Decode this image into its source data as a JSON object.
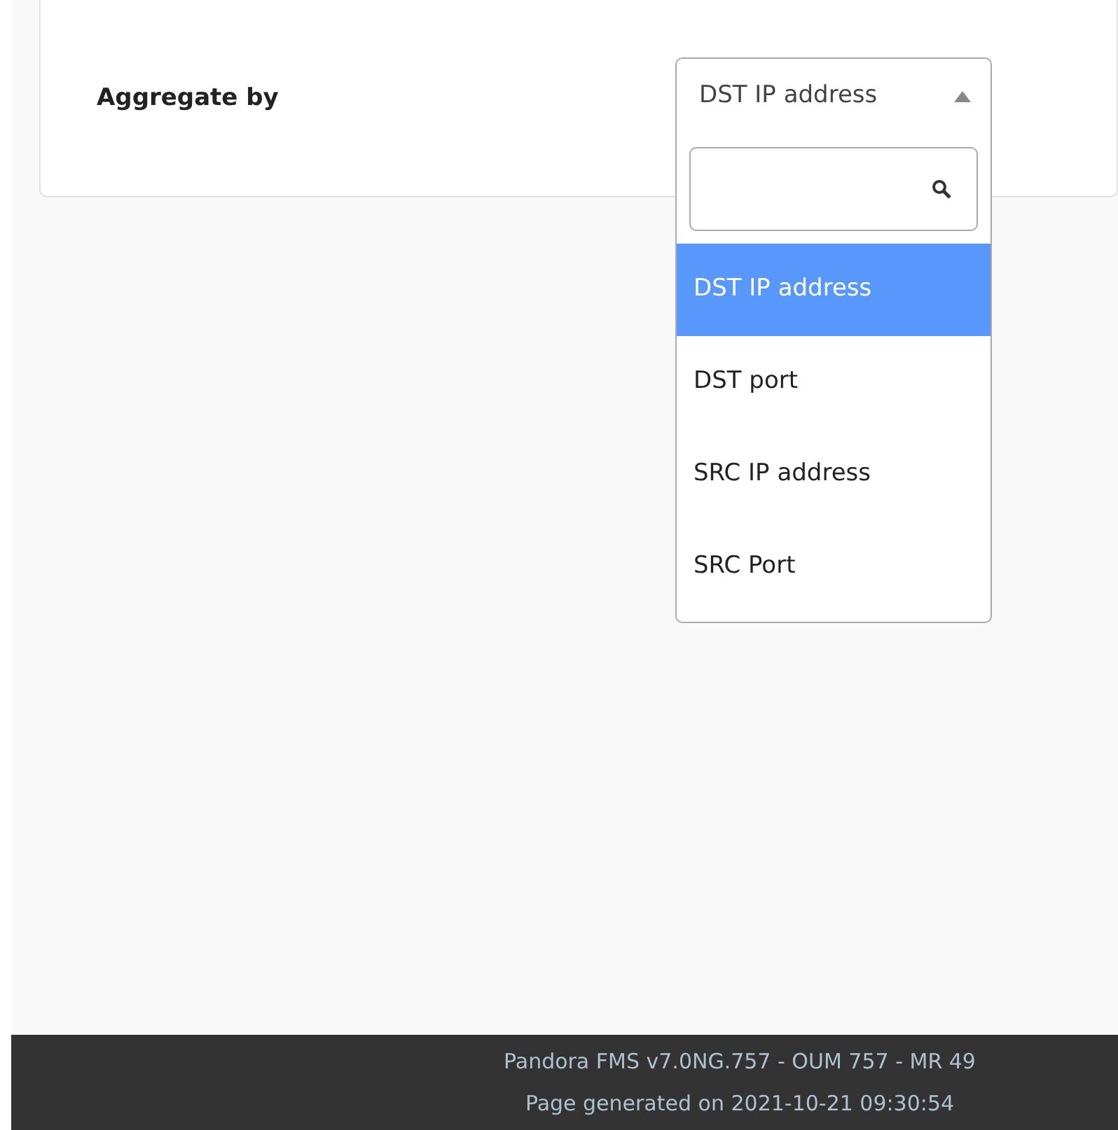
{
  "form": {
    "label": "Aggregate by",
    "select": {
      "value": "DST IP address",
      "expanded": true,
      "options": [
        {
          "label": "DST IP address",
          "selected": true
        },
        {
          "label": "DST port",
          "selected": false
        },
        {
          "label": "SRC IP address",
          "selected": false
        },
        {
          "label": "SRC Port",
          "selected": false
        }
      ]
    }
  },
  "footer": {
    "lines": [
      "Pandora FMS v7.0NG.757 - OUM 757 - MR 49",
      "Page generated on 2021-10-21 09:30:54"
    ]
  }
}
